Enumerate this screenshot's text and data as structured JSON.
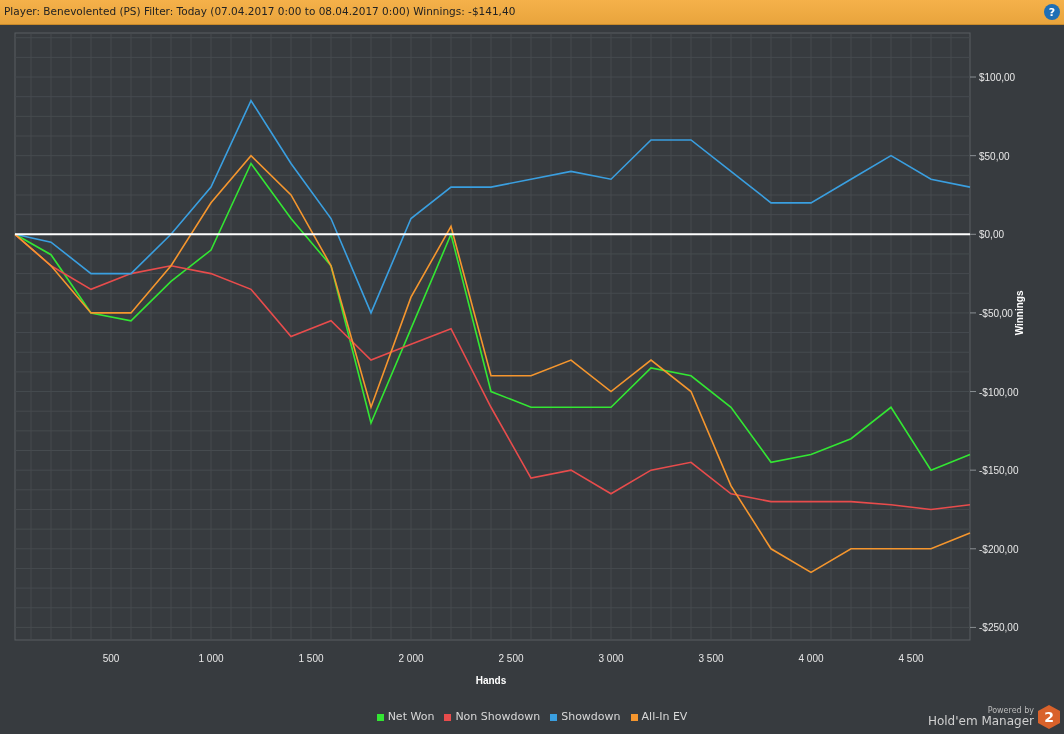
{
  "title_bar": {
    "text": "Player: Benevolented (PS) Filter: Today (07.04.2017 0:00 to 08.04.2017 0:00) Winnings: -$141,40",
    "help_label": "?"
  },
  "chart": {
    "chart_data": {
      "type": "line",
      "xlabel": "Hands",
      "ylabel": "Winnings",
      "xlim": [
        20,
        4795
      ],
      "ylim": [
        -258,
        128
      ],
      "grid": true,
      "xticks": [
        500,
        {
          "value": 1000,
          "label": "1 000"
        },
        {
          "value": 1500,
          "label": "1 500"
        },
        {
          "value": 2000,
          "label": "2 000"
        },
        {
          "value": 2500,
          "label": "2 500"
        },
        {
          "value": 3000,
          "label": "3 000"
        },
        {
          "value": 3500,
          "label": "3 500"
        },
        {
          "value": 4000,
          "label": "4 000"
        },
        {
          "value": 4500,
          "label": "4 500"
        }
      ],
      "yticks": [
        {
          "value": 100,
          "label": "$100,00"
        },
        {
          "value": 50,
          "label": "$50,00"
        },
        {
          "value": 0,
          "label": "$0,00"
        },
        {
          "value": -50,
          "label": "-$50,00"
        },
        {
          "value": -100,
          "label": "-$100,00"
        },
        {
          "value": -150,
          "label": "-$150,00"
        },
        {
          "value": -200,
          "label": "-$200,00"
        },
        {
          "value": -250,
          "label": "-$250,00"
        }
      ],
      "x": [
        20,
        200,
        400,
        600,
        800,
        1000,
        1200,
        1400,
        1600,
        1800,
        2000,
        2200,
        2400,
        2600,
        2800,
        3000,
        3200,
        3400,
        3600,
        3800,
        4000,
        4200,
        4400,
        4600,
        4795
      ],
      "series": [
        {
          "name": "Net Won",
          "color": "#33e633",
          "values": [
            0,
            -13,
            -50,
            -55,
            -30,
            -10,
            45,
            10,
            -20,
            -120,
            -60,
            0,
            -100,
            -110,
            -110,
            -110,
            -85,
            -90,
            -110,
            -145,
            -140,
            -130,
            -110,
            -150,
            -140
          ]
        },
        {
          "name": "Non Showdown",
          "color": "#e84c4c",
          "values": [
            0,
            -20,
            -35,
            -25,
            -20,
            -25,
            -35,
            -65,
            -55,
            -80,
            -70,
            -60,
            -110,
            -155,
            -150,
            -165,
            -150,
            -145,
            -165,
            -170,
            -170,
            -170,
            -172,
            -175,
            -172
          ]
        },
        {
          "name": "Showdown",
          "color": "#3a9fe0",
          "values": [
            0,
            -5,
            -25,
            -25,
            0,
            30,
            85,
            45,
            10,
            -50,
            10,
            30,
            30,
            35,
            40,
            35,
            60,
            60,
            40,
            20,
            20,
            35,
            50,
            35,
            30
          ]
        },
        {
          "name": "All-In EV",
          "color": "#f5962e",
          "values": [
            0,
            -20,
            -50,
            -50,
            -20,
            20,
            50,
            25,
            -20,
            -110,
            -40,
            5,
            -90,
            -90,
            -80,
            -100,
            -80,
            -100,
            -160,
            -200,
            -215,
            -200,
            -200,
            -200,
            -190
          ]
        }
      ]
    }
  },
  "branding": {
    "powered_by": "Powered by",
    "product": "Hold'em Manager",
    "badge": "2"
  }
}
